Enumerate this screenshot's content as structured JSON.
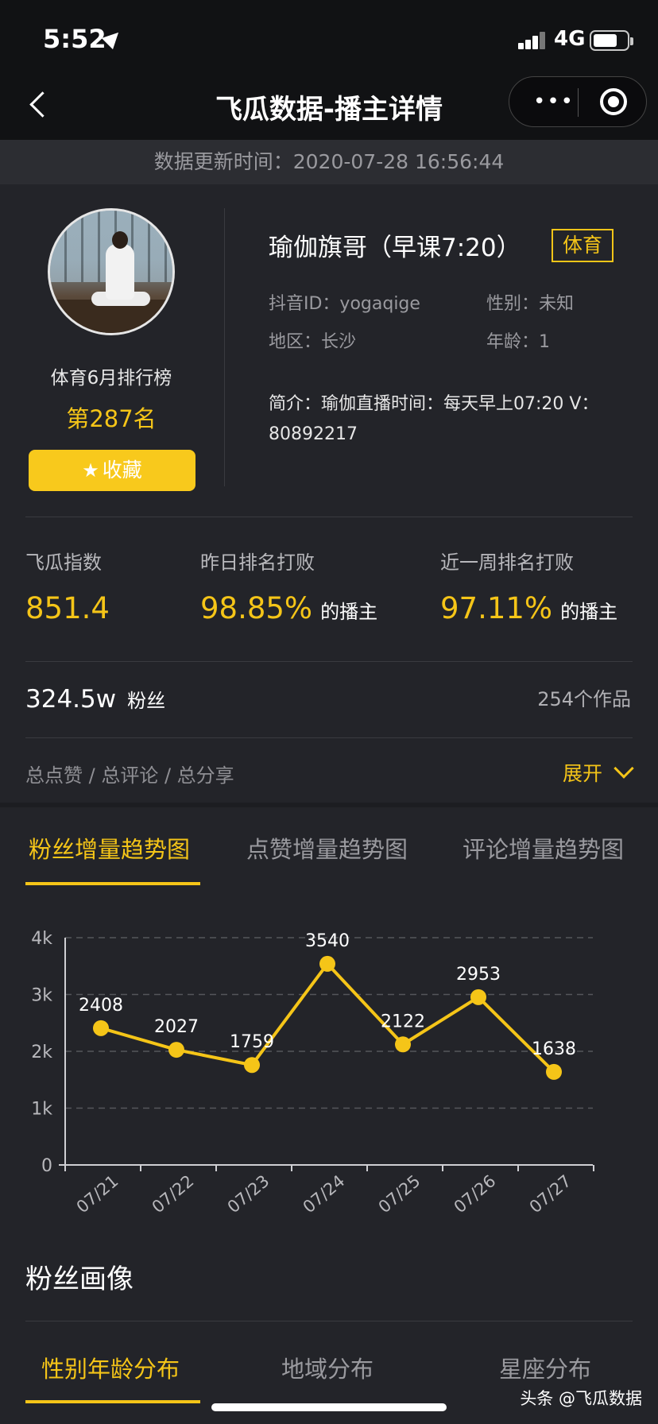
{
  "status": {
    "time": "5:52",
    "network": "4G",
    "battery_level": 0.72
  },
  "nav": {
    "title": "飞瓜数据-播主详情",
    "more_glyph": "•••"
  },
  "update": {
    "text": "数据更新时间：2020-07-28 16:56:44"
  },
  "profile": {
    "rank_label": "体育6月排行榜",
    "rank_value": "第287名",
    "favorite_label": "收藏",
    "name": "瑜伽旗哥（早课7:20）",
    "category": "体育",
    "douyin_id": "抖音ID：yogaqige",
    "gender": "性别：未知",
    "region": "地区：长沙",
    "age": "年龄：1",
    "bio": "简介：瑜伽直播时间：每天早上07:20 V：80892217"
  },
  "stats": [
    {
      "label": "飞瓜指数",
      "value": "851.4",
      "suffix": ""
    },
    {
      "label": "昨日排名打败",
      "value": "98.85%",
      "suffix": "的播主"
    },
    {
      "label": "近一周排名打败",
      "value": "97.11%",
      "suffix": "的播主"
    }
  ],
  "fans": {
    "count": "324.5w",
    "label": "粉丝",
    "works": "254个作品"
  },
  "totals": {
    "label": "总点赞 / 总评论 / 总分享",
    "expand": "展开"
  },
  "trend_tabs": [
    "粉丝增量趋势图",
    "点赞增量趋势图",
    "评论增量趋势图"
  ],
  "chart_data": {
    "type": "line",
    "categories": [
      "07/21",
      "07/22",
      "07/23",
      "07/24",
      "07/25",
      "07/26",
      "07/27"
    ],
    "values": [
      2408,
      2027,
      1759,
      3540,
      2122,
      2953,
      1638
    ],
    "ylim": [
      0,
      4000
    ],
    "y_ticks": [
      "0",
      "1k",
      "2k",
      "3k",
      "4k"
    ],
    "grid": true,
    "color": "#f5c518"
  },
  "portrait": {
    "title": "粉丝画像",
    "tabs": [
      "性别年龄分布",
      "地域分布",
      "星座分布"
    ]
  },
  "watermark": "头条 @飞瓜数据"
}
